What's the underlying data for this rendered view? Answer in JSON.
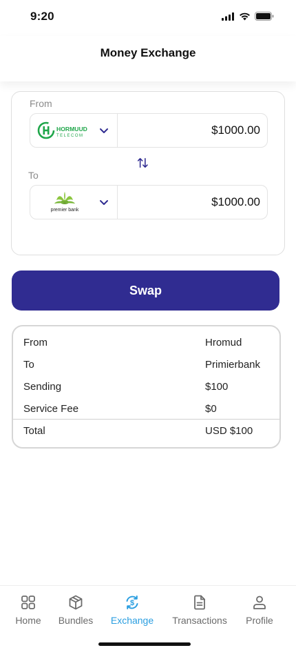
{
  "status_bar": {
    "time": "9:20"
  },
  "header": {
    "title": "Money Exchange"
  },
  "exchange": {
    "from_label": "From",
    "to_label": "To",
    "from": {
      "provider_name": "HORMUUD",
      "provider_sub": "TELECOM",
      "amount": "$1000.00"
    },
    "to": {
      "provider_name": "premier bank",
      "amount": "$1000.00"
    }
  },
  "swap_button": {
    "label": "Swap"
  },
  "summary": {
    "rows": [
      {
        "key": "From",
        "value": "Hromud"
      },
      {
        "key": "To",
        "value": "Primierbank"
      },
      {
        "key": "Sending",
        "value": "$100"
      },
      {
        "key": "Service Fee",
        "value": "$0"
      },
      {
        "key": "Total",
        "value": "USD $100"
      }
    ]
  },
  "tabbar": {
    "tabs": [
      {
        "label": "Home",
        "icon": "grid-icon"
      },
      {
        "label": "Bundles",
        "icon": "box-icon"
      },
      {
        "label": "Exchange",
        "icon": "exchange-icon",
        "active": true
      },
      {
        "label": "Transactions",
        "icon": "document-icon"
      },
      {
        "label": "Profile",
        "icon": "user-icon"
      }
    ]
  },
  "colors": {
    "primary": "#302c91",
    "active_tab": "#2a9ee0",
    "hormuud_green": "#1fa64a",
    "premier_green": "#8cc63f"
  }
}
